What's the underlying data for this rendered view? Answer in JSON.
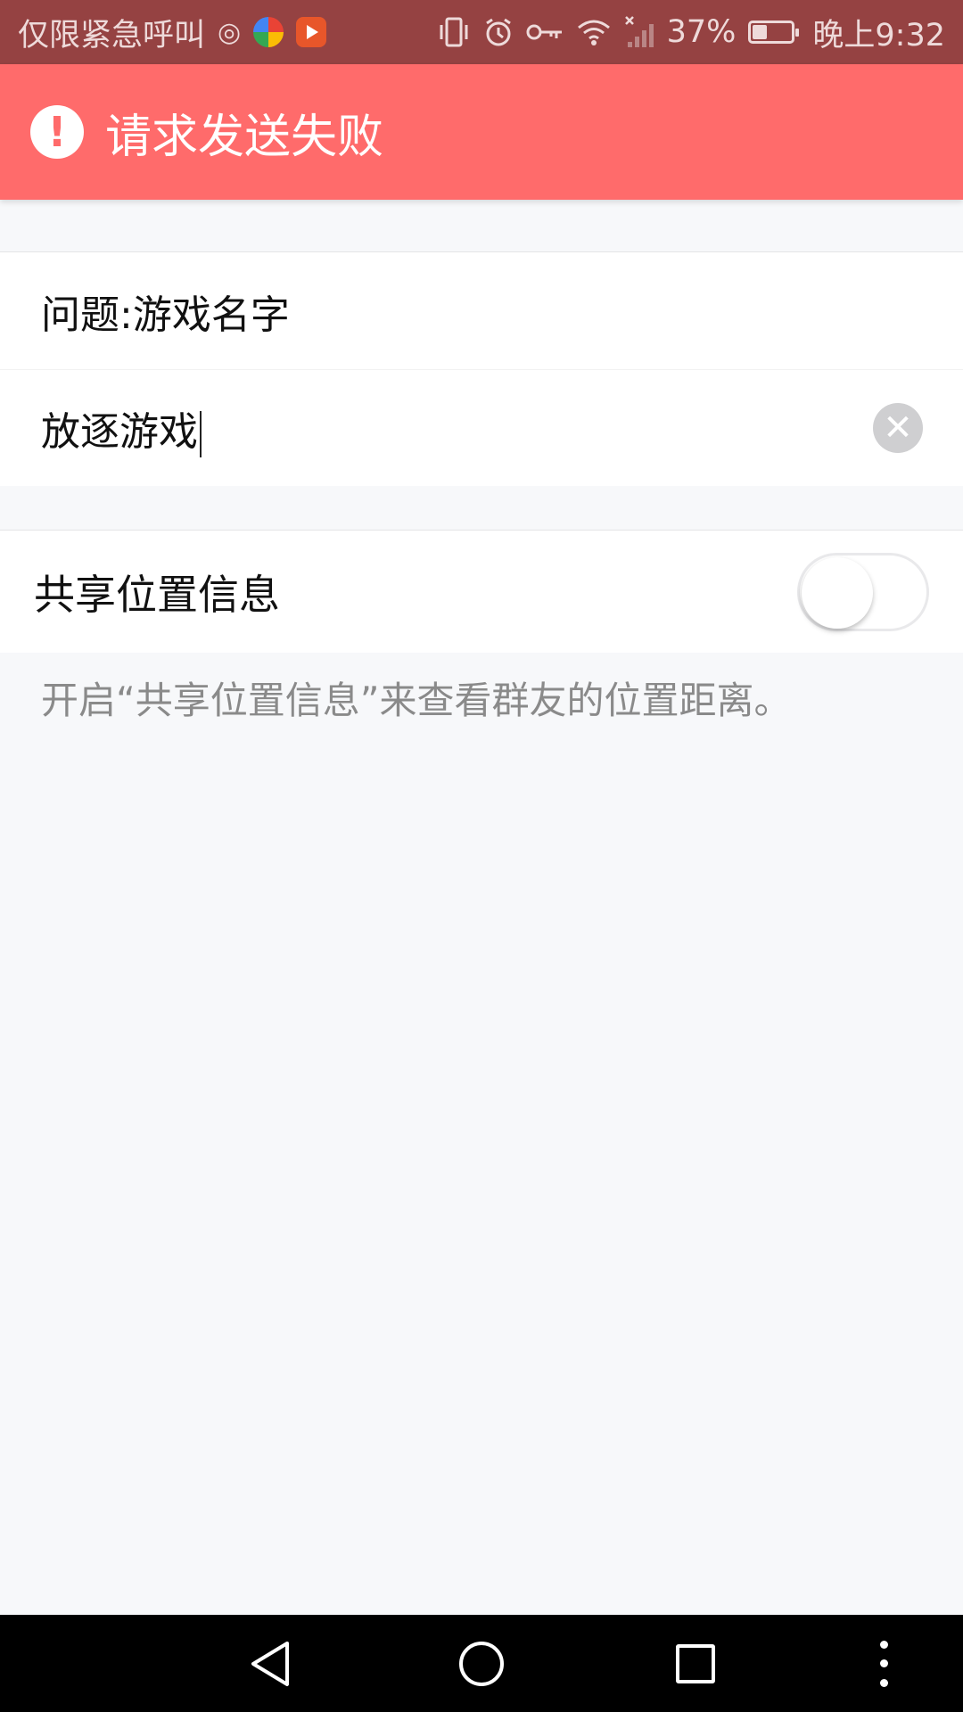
{
  "status_bar": {
    "carrier": "仅限紧急呼叫",
    "battery_percent": "37%",
    "battery_level": 0.37,
    "time": "晚上9:32",
    "icons": [
      "hotspot-icon",
      "app-colorful-icon",
      "app-play-icon",
      "vibrate-icon",
      "alarm-icon",
      "vpn-key-icon",
      "wifi-icon",
      "signal-icon",
      "battery-icon"
    ]
  },
  "error_banner": {
    "message": "请求发送失败",
    "icon": "alert-circle-icon",
    "color": "#ff6b6b"
  },
  "question": {
    "label": "问题:游戏名字",
    "answer_value": "放逐游戏",
    "clear_icon": "clear-icon"
  },
  "share_location": {
    "label": "共享位置信息",
    "enabled": false,
    "hint": "开启“共享位置信息”来查看群友的位置距离。"
  },
  "nav_bar": {
    "buttons": [
      "back-icon",
      "home-icon",
      "recent-apps-icon",
      "more-icon"
    ]
  }
}
